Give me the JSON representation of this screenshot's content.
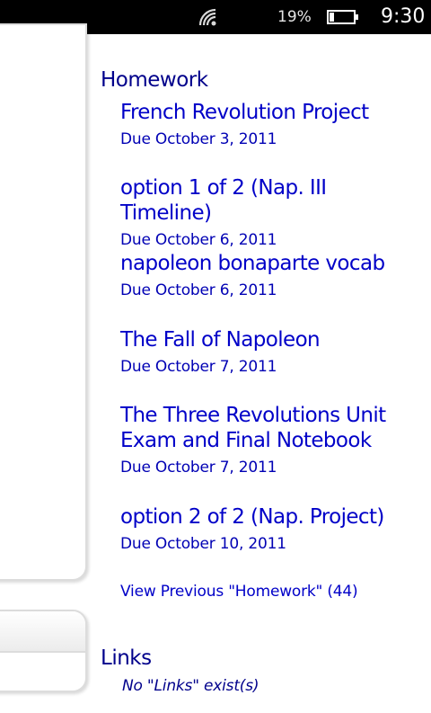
{
  "status_bar": {
    "battery_percent": "19%",
    "battery_level": 0.19,
    "time": "9:30",
    "signal_icon": "wifi-signal-icon",
    "battery_icon": "battery-icon"
  },
  "homework": {
    "heading": "Homework",
    "items": [
      {
        "title": "French Revolution Project",
        "due": "Due October 3, 2011"
      },
      {
        "title": "option 1 of 2 (Nap. III Timeline)",
        "due": "Due October 6, 2011"
      },
      {
        "title": "napoleon bonaparte vocab",
        "due": "Due October 6, 2011"
      },
      {
        "title": "The Fall of Napoleon",
        "due": "Due October 7, 2011"
      },
      {
        "title": "The Three Revolutions Unit Exam and Final Notebook",
        "due": "Due October 7, 2011"
      },
      {
        "title": "option 2 of 2 (Nap. Project)",
        "due": "Due October 10, 2011"
      }
    ],
    "view_previous": "View Previous \"Homework\" (44)"
  },
  "links": {
    "heading": "Links",
    "empty_message": "No \"Links\" exist(s)"
  },
  "colors": {
    "status_bar_bg": "#000000",
    "heading": "#00008b",
    "link": "#0000c8",
    "due_text": "#0000b4"
  }
}
